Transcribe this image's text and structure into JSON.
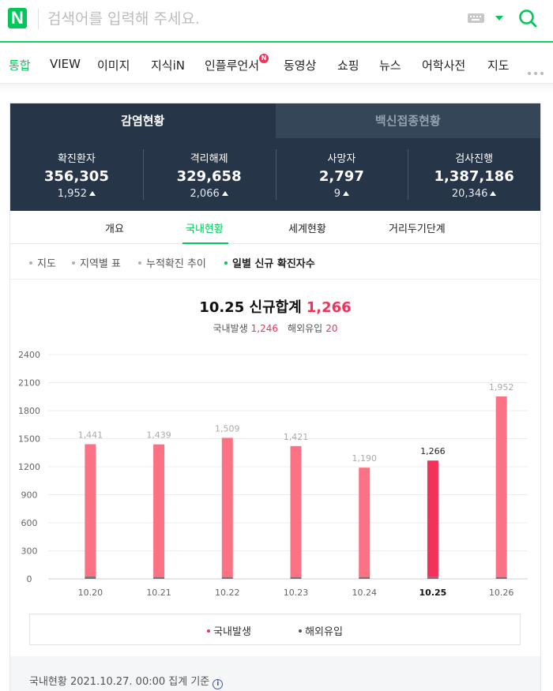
{
  "search": {
    "logo": "N",
    "placeholder": "검색어를 입력해 주세요."
  },
  "tabs": [
    {
      "label": "통합",
      "active": true
    },
    {
      "label": "VIEW"
    },
    {
      "label": "이미지"
    },
    {
      "label": "지식iN"
    },
    {
      "label": "인플루언서",
      "badge": "N"
    },
    {
      "label": "동영상"
    },
    {
      "label": "쇼핑"
    },
    {
      "label": "뉴스"
    },
    {
      "label": "어학사전"
    },
    {
      "label": "지도"
    }
  ],
  "panel": {
    "segments": [
      "감염현황",
      "백신접종현황"
    ],
    "stats": [
      {
        "label": "확진환자",
        "value": "356,305",
        "delta": "1,952"
      },
      {
        "label": "격리해제",
        "value": "329,658",
        "delta": "2,066"
      },
      {
        "label": "사망자",
        "value": "2,797",
        "delta": "9"
      },
      {
        "label": "검사진행",
        "value": "1,387,186",
        "delta": "20,346"
      }
    ],
    "subtabs": [
      "개요",
      "국내현황",
      "세계현황",
      "거리두기단계"
    ],
    "filters": [
      "지도",
      "지역별 표",
      "누적확진 추이",
      "일별 신규 확진자수"
    ],
    "chart_heading": {
      "date_label": "10.25 신규합계",
      "total": "1,266",
      "domestic_label": "국내발생",
      "domestic_value": "1,246",
      "imported_label": "해외유입",
      "imported_value": "20"
    },
    "legend": [
      "국내발생",
      "해외유입"
    ],
    "footer": "국내현황 2021.10.27. 00:00 집계 기준",
    "info_icon": "i"
  },
  "colors": {
    "brand": "#03c75a",
    "bar": "#fb7285",
    "bar_highlight": "#f2325b",
    "bar_imported": "#777777"
  },
  "chart_data": {
    "type": "bar",
    "stacked": true,
    "categories": [
      "10.20",
      "10.21",
      "10.22",
      "10.23",
      "10.24",
      "10.25",
      "10.26"
    ],
    "totals_labels": [
      "1,441",
      "1,439",
      "1,509",
      "1,421",
      "1,190",
      "1,266",
      "1,952"
    ],
    "series": [
      {
        "name": "국내발생",
        "values": [
          1416,
          1419,
          1489,
          1401,
          1170,
          1246,
          1932
        ]
      },
      {
        "name": "해외유입",
        "values": [
          25,
          20,
          20,
          20,
          20,
          20,
          20
        ]
      }
    ],
    "highlight_category": "10.25",
    "yticks": [
      0,
      300,
      600,
      900,
      1200,
      1500,
      1800,
      2100,
      2400
    ],
    "ylim": [
      0,
      2400
    ],
    "grid": true,
    "legend_position": "bottom"
  }
}
